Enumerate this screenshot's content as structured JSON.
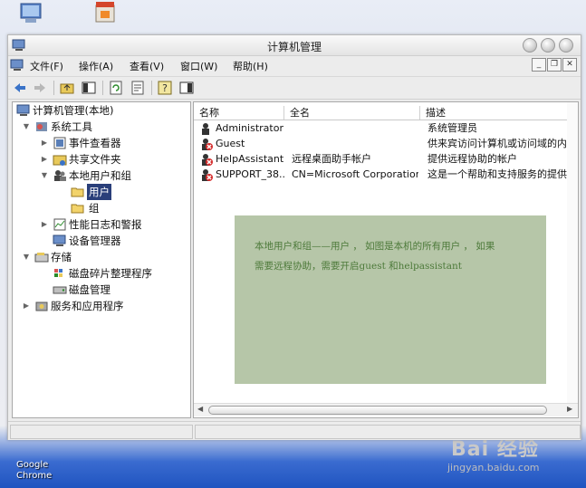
{
  "window": {
    "title": "计算机管理"
  },
  "menu": [
    {
      "label": "文件(F)"
    },
    {
      "label": "操作(A)"
    },
    {
      "label": "查看(V)"
    },
    {
      "label": "窗口(W)"
    },
    {
      "label": "帮助(H)"
    }
  ],
  "tree": {
    "root": "计算机管理(本地)",
    "system_tools": "系统工具",
    "event_viewer": "事件查看器",
    "shared_folders": "共享文件夹",
    "local_users_groups": "本地用户和组",
    "users": "用户",
    "groups": "组",
    "perf_logs": "性能日志和警报",
    "device_manager": "设备管理器",
    "storage": "存储",
    "defrag": "磁盘碎片整理程序",
    "disk_mgmt": "磁盘管理",
    "services_apps": "服务和应用程序"
  },
  "list": {
    "headers": [
      "名称",
      "全名",
      "描述"
    ],
    "rows": [
      {
        "name": "Administrator",
        "full": "",
        "desc": "系统管理员",
        "disabled": false
      },
      {
        "name": "Guest",
        "full": "",
        "desc": "供来宾访问计算机或访问域的内",
        "disabled": true
      },
      {
        "name": "HelpAssistant",
        "full": "远程桌面助手帐户",
        "desc": "提供远程协助的帐户",
        "disabled": true
      },
      {
        "name": "SUPPORT_38...",
        "full": "CN=Microsoft Corporation...",
        "desc": "这是一个帮助和支持服务的提供",
        "disabled": true
      }
    ]
  },
  "annotation": {
    "line1": "本地用户和组——用户 ， 如图是本机的所有用户 ， 如果",
    "line2": "需要远程协助，需要开启guest 和helpassistant"
  },
  "desktop": {
    "chrome_line1": "Google",
    "chrome_line2": "Chrome",
    "watermark": "Bai 经验",
    "watermark_url": "jingyan.baidu.com"
  },
  "colors": {
    "selection": "#2a3f7a",
    "note_bg": "#b6c6a8",
    "note_text": "#4d7a3a",
    "disabled_badge": "#d42a2a"
  }
}
